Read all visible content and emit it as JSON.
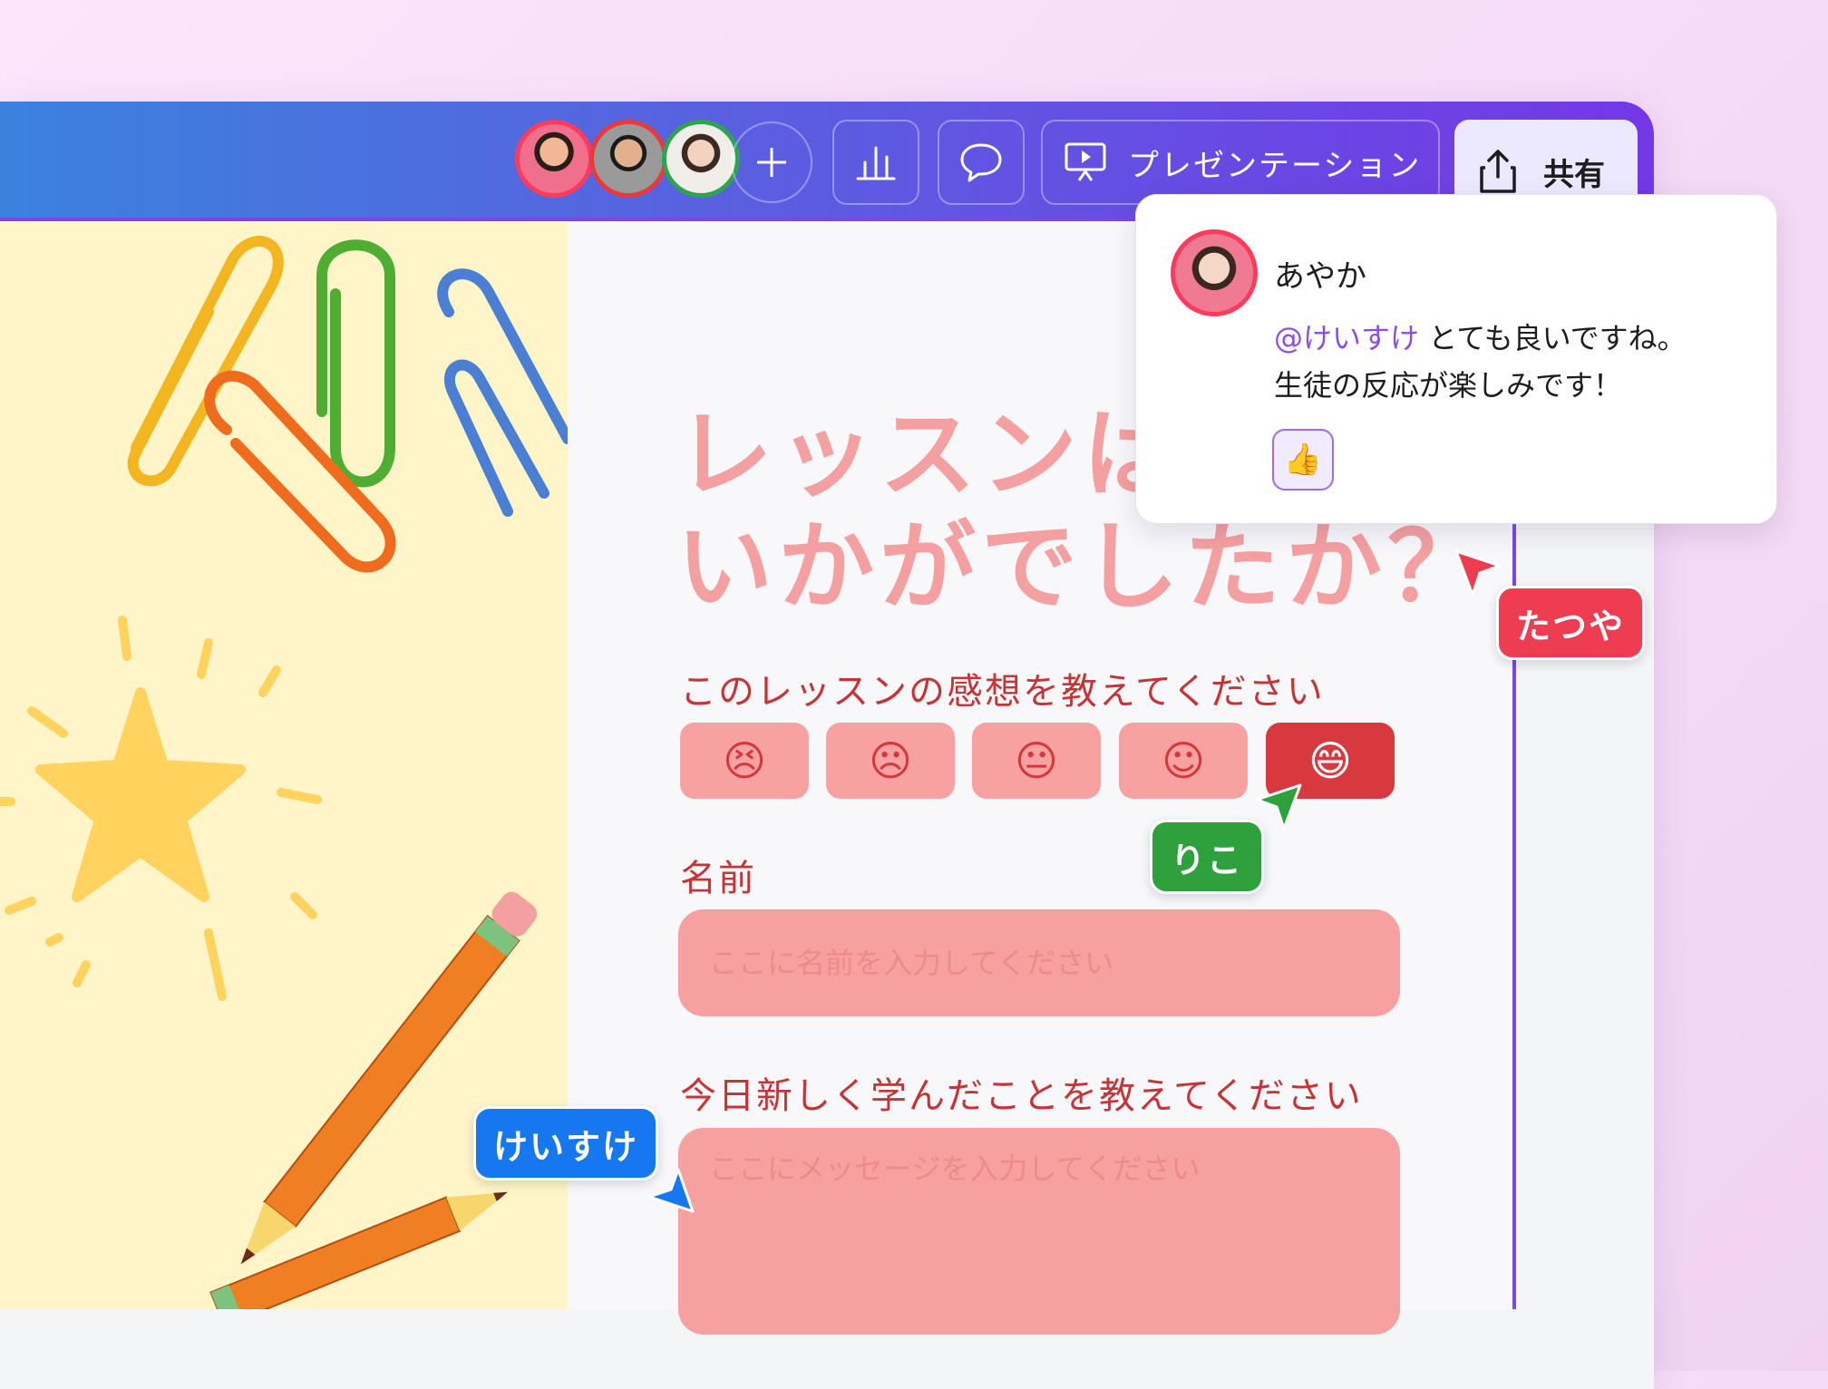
{
  "toolbar": {
    "collaborators": [
      {
        "name": "avatar-1",
        "ring": "#ff3b5c"
      },
      {
        "name": "avatar-2",
        "ring": "#e83a3a"
      },
      {
        "name": "avatar-3",
        "ring": "#2da44e"
      }
    ],
    "present_label": "プレゼンテーション",
    "share_label": "共有"
  },
  "slide": {
    "title_line1": "レッスンは",
    "title_line2": "いかがでしたか？",
    "rating_label": "このレッスンの感想を教えてください",
    "ratings": [
      "😣",
      "☹",
      "😐",
      "☺",
      "😄"
    ],
    "selected_rating_index": 4,
    "name_label": "名前",
    "name_placeholder": "ここに名前を入力してください",
    "learned_label": "今日新しく学んだことを教えてください",
    "message_placeholder": "ここにメッセージを入力してください"
  },
  "comment": {
    "author": "あやか",
    "mention": "@けいすけ",
    "text_line1": " とても良いですね。",
    "text_line2": "生徒の反応が楽しみです！",
    "reaction": "👍"
  },
  "cursors": {
    "tatsuya": {
      "label": "たつや",
      "color": "#ee3d50"
    },
    "riko": {
      "label": "りこ",
      "color": "#2ea13c"
    },
    "keisuke": {
      "label": "けいすけ",
      "color": "#1677ef"
    }
  }
}
